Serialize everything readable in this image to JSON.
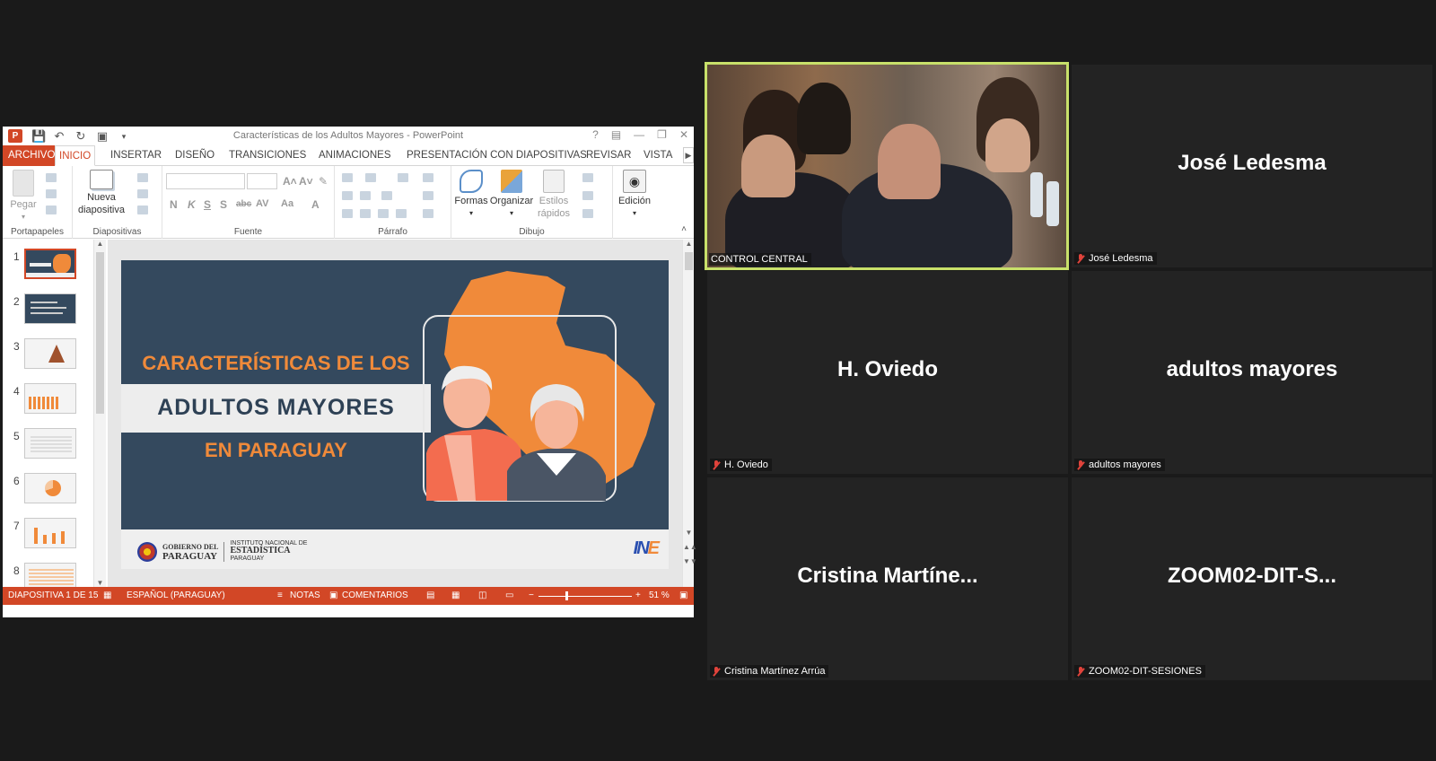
{
  "ppt": {
    "window_title": "Características de los Adultos Mayores - PowerPoint",
    "logo": "P",
    "tabs": [
      "ARCHIVO",
      "INICIO",
      "INSERTAR",
      "DISEÑO",
      "TRANSICIONES",
      "ANIMACIONES",
      "PRESENTACIÓN CON DIAPOSITIVAS",
      "REVISAR",
      "VISTA"
    ],
    "active_tab": "INICIO",
    "ribbon": {
      "pegar": "Pegar",
      "nueva": "Nueva",
      "diapositiva": "diapositiva",
      "formas": "Formas",
      "organizar": "Organizar",
      "estilos": "Estilos",
      "rapidos": "rápidos",
      "edicion": "Edición",
      "groups": {
        "portapapeles": "Portapapeles",
        "diapositivas": "Diapositivas",
        "fuente": "Fuente",
        "parrafo": "Párrafo",
        "dibujo": "Dibujo"
      }
    },
    "thumb_numbers": [
      "1",
      "2",
      "3",
      "4",
      "5",
      "6",
      "7",
      "8"
    ],
    "slide": {
      "line1": "CARACTERÍSTICAS DE LOS",
      "line2": "ADULTOS  MAYORES",
      "line3": "EN PARAGUAY",
      "gob_line1": "GOBIERNO DEL",
      "gob_line2": "PARAGUAY",
      "ine_line1": "INSTITUTO NACIONAL DE",
      "ine_line2": "ESTADÍSTICA",
      "ine_line3": "PARAGUAY",
      "ine_logo_a": "IN",
      "ine_logo_b": "E"
    },
    "status": {
      "slide_of": "DIAPOSITIVA 1 DE 15",
      "language": "ESPAÑOL (PARAGUAY)",
      "notas": "NOTAS",
      "comentarios": "COMENTARIOS",
      "zoom": "51 %"
    },
    "colors": {
      "accent": "#d24726",
      "slide_bg": "#34495e",
      "slide_orange": "#f08a3a"
    }
  },
  "gallery": {
    "tiles": [
      {
        "id": "control-central",
        "label": "CONTROL CENTRAL",
        "video": true,
        "speaking": true
      },
      {
        "id": "jose-ledesma",
        "name": "José Ledesma",
        "label": "José Ledesma",
        "muted": true
      },
      {
        "id": "h-oviedo",
        "name": "H. Oviedo",
        "label": "H. Oviedo",
        "muted": true
      },
      {
        "id": "adultos-mayores",
        "name": "adultos mayores",
        "label": "adultos mayores",
        "muted": true
      },
      {
        "id": "cristina",
        "name": "Cristina  Martíne...",
        "label": "Cristina Martínez Arrúa",
        "muted": true
      },
      {
        "id": "zoom02",
        "name": "ZOOM02-DIT-S...",
        "label": "ZOOM02-DIT-SESIONES",
        "muted": true
      }
    ],
    "colors": {
      "speaking_border": "#c8e06a",
      "muted_icon": "#e0433b",
      "tile_bg": "#232323"
    }
  }
}
